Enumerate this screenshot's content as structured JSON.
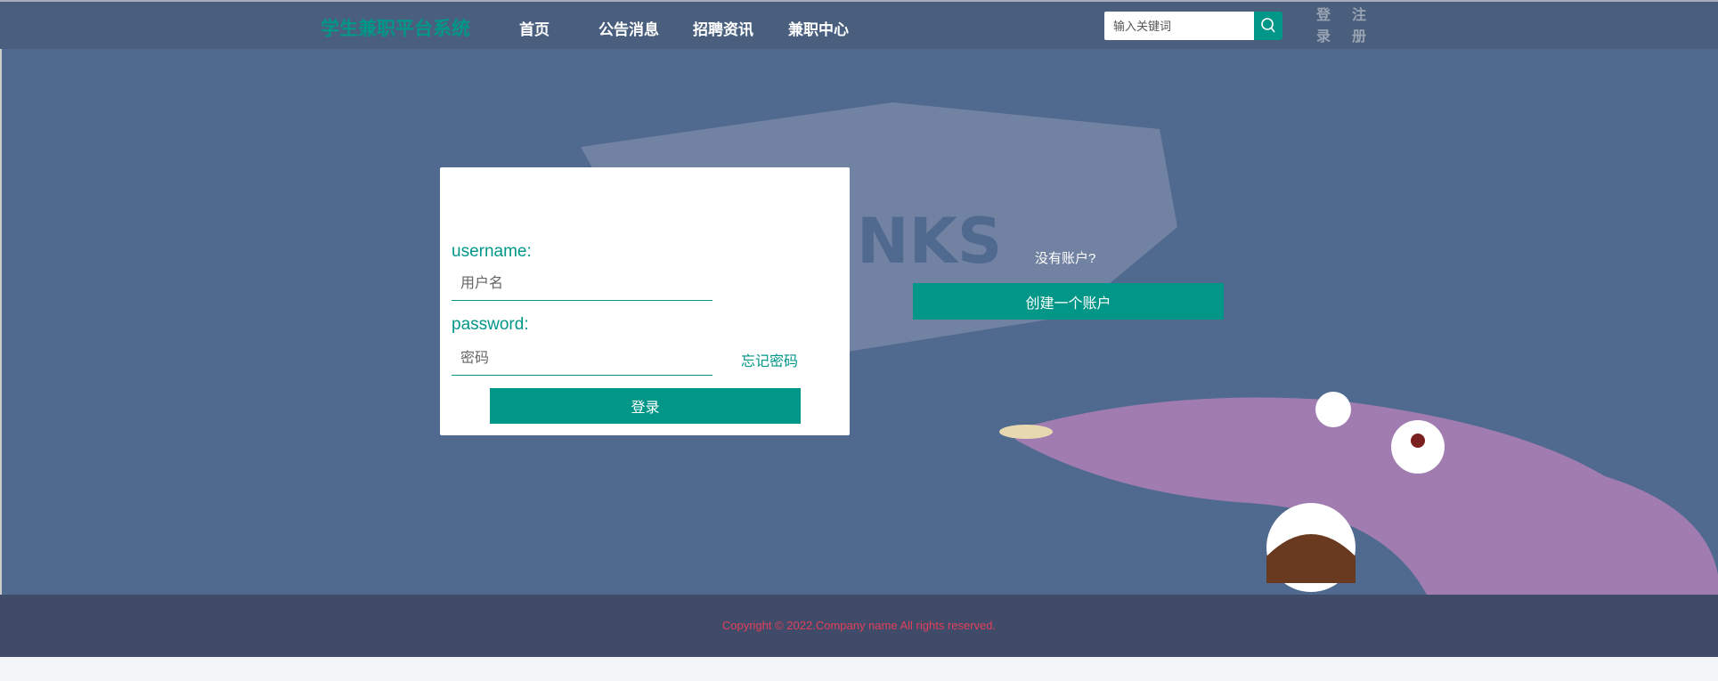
{
  "header": {
    "brand": "学生兼职平台系统",
    "nav": [
      "首页",
      "公告消息",
      "招聘资讯",
      "兼职中心"
    ],
    "search_placeholder": "输入关键词",
    "login": [
      "登",
      "录"
    ],
    "register": [
      "注",
      "册"
    ]
  },
  "login_form": {
    "username_label": "username:",
    "username_placeholder": "用户名",
    "password_label": "password:",
    "password_placeholder": "密码",
    "forgot": "忘记密码",
    "submit": "登录"
  },
  "signup": {
    "prompt": "没有账户?",
    "button": "创建一个账户"
  },
  "footer": {
    "copyright": "Copyright © 2022.Company name All rights reserved."
  },
  "colors": {
    "accent": "#009688",
    "header": "#4a5f7e",
    "background": "#506a8f",
    "footer": "#404b6a",
    "copyright": "#e0405a"
  }
}
